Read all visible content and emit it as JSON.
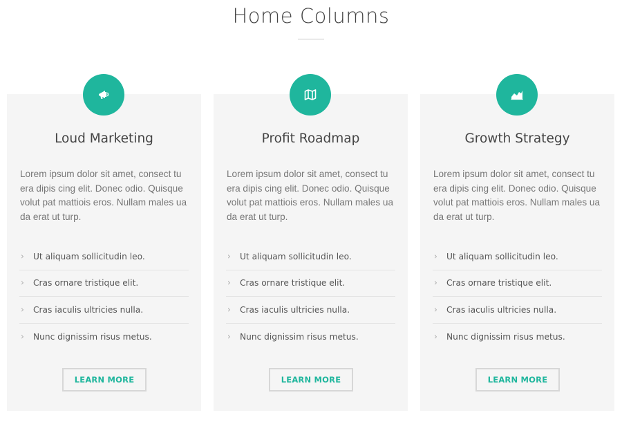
{
  "header": {
    "title": "Home Columns"
  },
  "theme": {
    "accent": "#1fb69d",
    "card_bg": "#f5f5f5"
  },
  "columns": [
    {
      "icon": "megaphone-icon",
      "title": "Loud Marketing",
      "text": "Lorem ipsum dolor sit amet, consect tu era dipis cing elit. Donec odio. Quisque volut pat mattiois eros. Nullam males ua da erat ut turp.",
      "items": [
        "Ut aliquam sollicitudin leo.",
        "Cras ornare tristique elit.",
        "Cras iaculis ultricies nulla.",
        "Nunc dignissim risus metus."
      ],
      "button": "LEARN MORE"
    },
    {
      "icon": "map-icon",
      "title": "Profit Roadmap",
      "text": "Lorem ipsum dolor sit amet, consect tu era dipis cing elit. Donec odio. Quisque volut pat mattiois eros. Nullam males ua da erat ut turp.",
      "items": [
        "Ut aliquam sollicitudin leo.",
        "Cras ornare tristique elit.",
        "Cras iaculis ultricies nulla.",
        "Nunc dignissim risus metus."
      ],
      "button": "LEARN MORE"
    },
    {
      "icon": "area-chart-icon",
      "title": "Growth Strategy",
      "text": "Lorem ipsum dolor sit amet, consect tu era dipis cing elit. Donec odio. Quisque volut pat mattiois eros. Nullam males ua da erat ut turp.",
      "items": [
        "Ut aliquam sollicitudin leo.",
        "Cras ornare tristique elit.",
        "Cras iaculis ultricies nulla.",
        "Nunc dignissim risus metus."
      ],
      "button": "LEARN MORE"
    }
  ]
}
